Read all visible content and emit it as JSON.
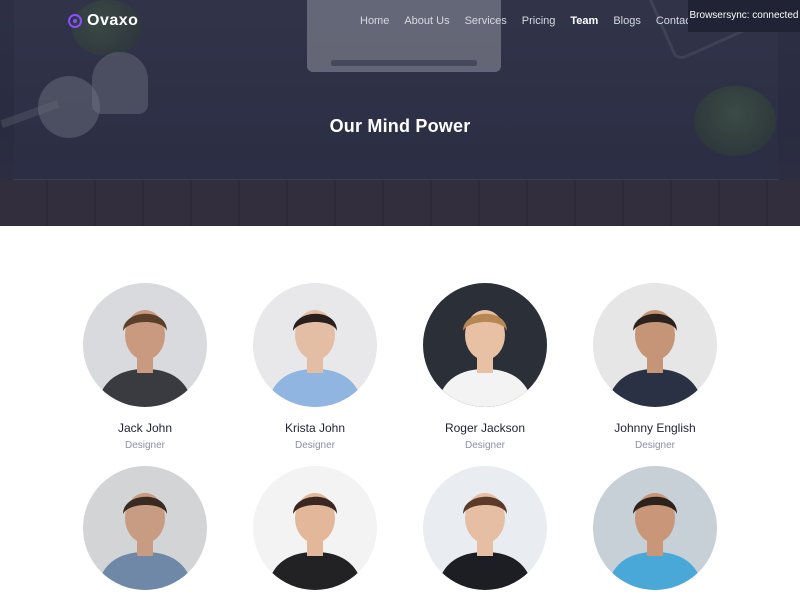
{
  "brand": {
    "name": "Ovaxo",
    "accent": "#8a4dff"
  },
  "nav": {
    "items": [
      {
        "label": "Home",
        "active": false
      },
      {
        "label": "About Us",
        "active": false
      },
      {
        "label": "Services",
        "active": false
      },
      {
        "label": "Pricing",
        "active": false
      },
      {
        "label": "Team",
        "active": true
      },
      {
        "label": "Blogs",
        "active": false
      },
      {
        "label": "Contact us",
        "active": false
      }
    ]
  },
  "toast": {
    "text": "Browsersync: connected"
  },
  "hero": {
    "title": "Our Mind Power"
  },
  "team": {
    "members": [
      {
        "name": "Jack John",
        "role": "Designer",
        "bg": "#d8dadd",
        "skin": "#c99a80",
        "hair": "#5a3f2a",
        "shirt": "#3a3b40"
      },
      {
        "name": "Krista John",
        "role": "Designer",
        "bg": "#e8e8ea",
        "skin": "#e4bea4",
        "hair": "#2a1f1c",
        "shirt": "#8fb5e0"
      },
      {
        "name": "Roger Jackson",
        "role": "Designer",
        "bg": "#2a2f38",
        "skin": "#e8c0a4",
        "hair": "#b78752",
        "shirt": "#f3f3f3"
      },
      {
        "name": "Johnny English",
        "role": "Designer",
        "bg": "#e6e6e6",
        "skin": "#c69578",
        "hair": "#2b221d",
        "shirt": "#2a3144"
      },
      {
        "name": "",
        "role": "",
        "bg": "#d3d4d6",
        "skin": "#c79c82",
        "hair": "#3a2b22",
        "shirt": "#6f88a8"
      },
      {
        "name": "",
        "role": "",
        "bg": "#f3f3f3",
        "skin": "#e3b79a",
        "hair": "#3b2620",
        "shirt": "#222225"
      },
      {
        "name": "",
        "role": "",
        "bg": "#e9edf2",
        "skin": "#e6bea3",
        "hair": "#5b3a2a",
        "shirt": "#1d1e24"
      },
      {
        "name": "",
        "role": "",
        "bg": "#c7cfd7",
        "skin": "#c9967a",
        "hair": "#2d221c",
        "shirt": "#4aa8d8"
      }
    ]
  }
}
